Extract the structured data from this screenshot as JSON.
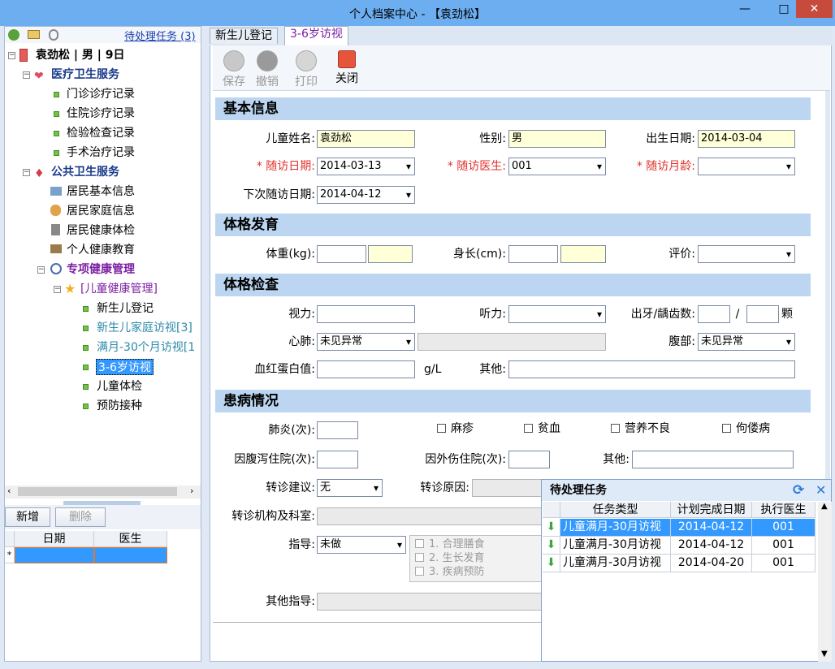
{
  "window": {
    "title": "个人档案中心 - 【袁劲松】",
    "minimize": "—",
    "maximize": "□",
    "close": "✕"
  },
  "left_toolbar": {
    "icons": [
      "person-icon",
      "card-icon",
      "fingerprint-icon"
    ],
    "pending_link": "待处理任务 (3)"
  },
  "tree": {
    "root": "袁劲松 | 男 | 9日",
    "medical": {
      "label": "医疗卫生服务",
      "items": [
        "门诊诊疗记录",
        "住院诊疗记录",
        "检验检查记录",
        "手术治疗记录"
      ]
    },
    "public": {
      "label": "公共卫生服务",
      "items": [
        "居民基本信息",
        "居民家庭信息",
        "居民健康体检",
        "个人健康教育"
      ]
    },
    "special": {
      "label": "专项健康管理",
      "child": "[儿童健康管理]",
      "items": [
        "新生儿登记",
        "新生儿家庭访视[3]",
        "满月-30个月访视[1",
        "3-6岁访视",
        "儿童体检",
        "预防接种"
      ]
    }
  },
  "left_buttons": {
    "add": "新增",
    "delete": "删除"
  },
  "left_grid": {
    "headers": [
      "日期",
      "医生"
    ],
    "row_marker": "*"
  },
  "tabs": [
    "新生儿登记",
    "3-6岁访视"
  ],
  "toolbar": {
    "save": "保存",
    "undo": "撤销",
    "print": "打印",
    "close": "关闭"
  },
  "sections": {
    "basic": "基本信息",
    "growth": "体格发育",
    "exam": "体格检查",
    "disease": "患病情况"
  },
  "basic": {
    "name_label": "儿童姓名:",
    "name": "袁劲松",
    "sex_label": "性别:",
    "sex": "男",
    "birth_label": "出生日期:",
    "birth": "2014-03-04",
    "visit_date_label": "* 随访日期:",
    "visit_date": "2014-03-13",
    "doctor_label": "* 随访医生:",
    "doctor": "001",
    "age_label": "* 随访月龄:",
    "age": "",
    "next_label": "下次随访日期:",
    "next": "2014-04-12"
  },
  "growth": {
    "weight_label": "体重(kg):",
    "height_label": "身长(cm):",
    "eval_label": "评价:"
  },
  "exam": {
    "vision_label": "视力:",
    "hearing_label": "听力:",
    "teeth_label": "出牙/龋齿数:",
    "teeth_sep": "/",
    "teeth_unit": "颗",
    "heart_label": "心肺:",
    "heart": "未见异常",
    "abdomen_label": "腹部:",
    "abdomen": "未见异常",
    "hb_label": "血红蛋白值:",
    "hb_unit": "g/L",
    "other_label": "其他:"
  },
  "disease": {
    "pneumonia_label": "肺炎(次):",
    "measles": "麻疹",
    "anemia": "贫血",
    "malnutrition": "营养不良",
    "rickets": "佝偻病",
    "diarrhea_label": "因腹泻住院(次):",
    "injury_label": "因外伤住院(次):",
    "other_label": "其他:",
    "referral_label": "转诊建议:",
    "referral": "无",
    "reason_label": "转诊原因:",
    "institution_label": "转诊机构及科室:",
    "guide_label": "指导:",
    "guide": "未做",
    "guide_options": [
      "1. 合理膳食",
      "2. 生长发育",
      "3. 疾病预防"
    ],
    "other_guide_label": "其他指导:"
  },
  "pending": {
    "title": "待处理任务",
    "headers": [
      "任务类型",
      "计划完成日期",
      "执行医生"
    ],
    "rows": [
      {
        "type": "儿童满月-30月访视",
        "date": "2014-04-12",
        "doctor": "001"
      },
      {
        "type": "儿童满月-30月访视",
        "date": "2014-04-12",
        "doctor": "001"
      },
      {
        "type": "儿童满月-30月访视",
        "date": "2014-04-20",
        "doctor": "001"
      }
    ]
  },
  "colors": {
    "accent": "#3399ff",
    "header_blue": "#bcd6f1",
    "required_red": "#e0312b"
  }
}
